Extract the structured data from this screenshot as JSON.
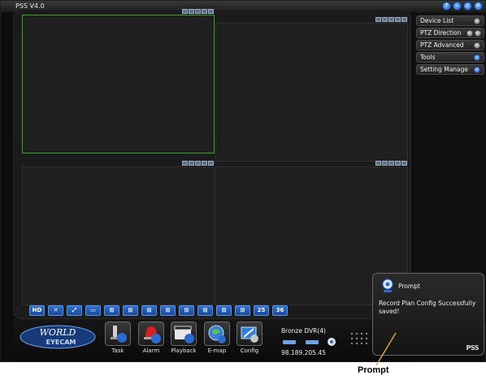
{
  "app": {
    "title": "PSS  V4.0"
  },
  "window_buttons": [
    "help",
    "minimize",
    "restore",
    "close"
  ],
  "layout_bar": [
    "HD",
    "",
    "",
    "",
    "",
    "",
    "",
    "",
    "",
    "",
    "",
    "",
    "25",
    "36"
  ],
  "right_panel": {
    "items": [
      {
        "label": "Device List"
      },
      {
        "label": "PTZ Direction"
      },
      {
        "label": "PTZ Advanced"
      },
      {
        "label": "Tools"
      },
      {
        "label": "Setting Manage"
      }
    ]
  },
  "toolbar": {
    "logo_text": "WORLD EYECAM",
    "items": [
      {
        "label": "Task",
        "icon": "task-icon"
      },
      {
        "label": "Alarm",
        "icon": "alarm-icon"
      },
      {
        "label": "Playback",
        "icon": "playback-icon"
      },
      {
        "label": "E-map",
        "icon": "emap-icon"
      },
      {
        "label": "Config",
        "icon": "config-icon"
      }
    ]
  },
  "device": {
    "name": "Bronze DVR(4)",
    "ip": "98.189.205.45"
  },
  "prompt": {
    "title": "Prompt",
    "message": "Record Plan Config Successfully saved!",
    "brand": "PSS"
  },
  "annotation": {
    "label": "Prompt",
    "color": "#e0a040"
  },
  "colors": {
    "active_cell": "#3fa02c",
    "accent_blue": "#2b6bd0"
  }
}
